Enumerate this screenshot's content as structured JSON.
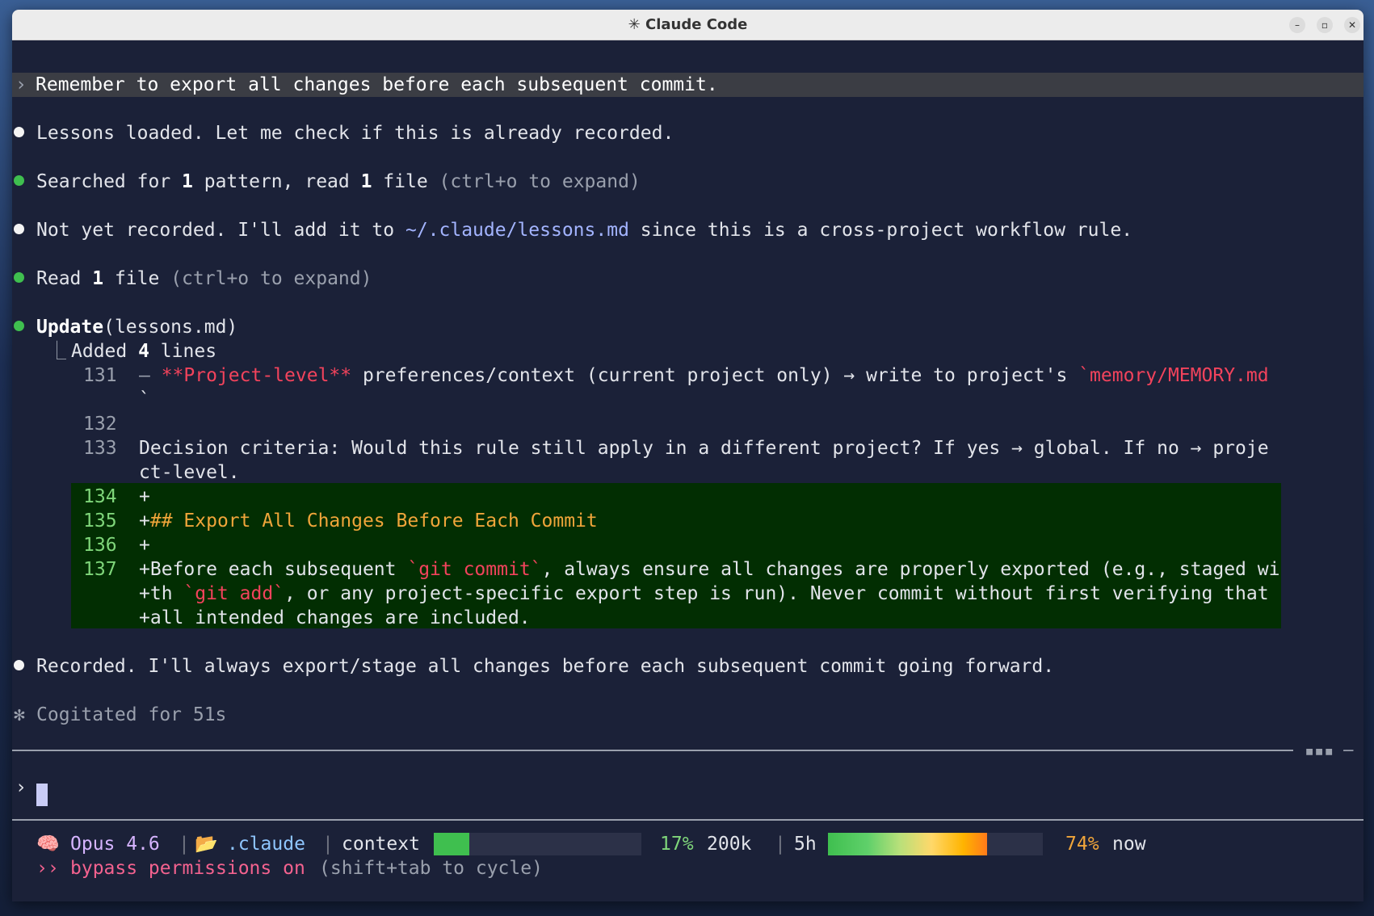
{
  "window": {
    "title": "✳ Claude Code",
    "minimize": "–",
    "maximize": "▫",
    "close": "✕"
  },
  "messages": {
    "user_prompt_marker": "›",
    "user_prompt": "Remember to export all changes before each subsequent commit.",
    "m1": "Lessons loaded. Let me check if this is already recorded.",
    "m2_a": "Searched for ",
    "m2_n1": "1",
    "m2_b": " pattern, read ",
    "m2_n2": "1",
    "m2_c": " file ",
    "m2_hint": "(ctrl+o to expand)",
    "m3_a": "Not yet recorded. I'll add it to ",
    "m3_path": "~/.claude/lessons.md",
    "m3_b": " since this is a cross-project workflow rule.",
    "m4_a": "Read ",
    "m4_n": "1",
    "m4_b": " file ",
    "m4_hint": "(ctrl+o to expand)",
    "m5_tool": "Update",
    "m5_arg": "(lessons.md)",
    "m5_tree": "⎿",
    "m5_added_a": "Added ",
    "m5_added_n": "4",
    "m5_added_b": " lines",
    "m6": "Recorded. I'll always export/stage all changes before each subsequent commit going forward.",
    "m7_marker": "✻",
    "m7": "Cogitated for 51s"
  },
  "diff": {
    "l131_num": "131",
    "l131_sign": "– ",
    "l131_red": "**Project-level**",
    "l131_text": " preferences/context (current project only) → write to project's ",
    "l131_code": "`memory/MEMORY.md",
    "l131_wrap": "`",
    "l132_num": "132",
    "l133_num": "133",
    "l133_text": "Decision criteria: Would this rule still apply in a different project? If yes → global. If no → proje",
    "l133_wrap": "ct-level.",
    "l134_num": "134",
    "l134_text": "+",
    "l135_num": "135",
    "l135_plus": "+",
    "l135_heading": "## Export All Changes Before Each Commit",
    "l136_num": "136",
    "l136_text": "+",
    "l137_num": "137",
    "l137_a": "+Before each subsequent ",
    "l137_code1": "`git commit`",
    "l137_b": ", always ensure all changes are properly exported (e.g., staged wi",
    "l137_w1a": "+th ",
    "l137_code2": "`git add`",
    "l137_w1b": ", or any project-specific export step is run). Never commit without first verifying that",
    "l137_w2": "+all intended changes are included."
  },
  "input": {
    "marker": "›",
    "dashes": "▪▪▪ ─"
  },
  "status": {
    "model_icon": "🧠",
    "model": "Opus 4.6",
    "folder_icon": "📂",
    "folder": ".claude",
    "sep": "|",
    "context_label": "context",
    "context_fill": 0.17,
    "context_pct": "17%",
    "context_total": "200k",
    "session_label": "5h",
    "session_fill": 0.74,
    "session_pct": "74%",
    "session_reset": "now",
    "mode_icon": "››",
    "mode": "bypass permissions on",
    "mode_hint": "(shift+tab to cycle)",
    "colors": {
      "green": "#3fbf4f",
      "orange": "#f0a53a",
      "pink": "#f4628f",
      "purple": "#d6b4ff",
      "cyan": "#8fc6ff"
    }
  }
}
